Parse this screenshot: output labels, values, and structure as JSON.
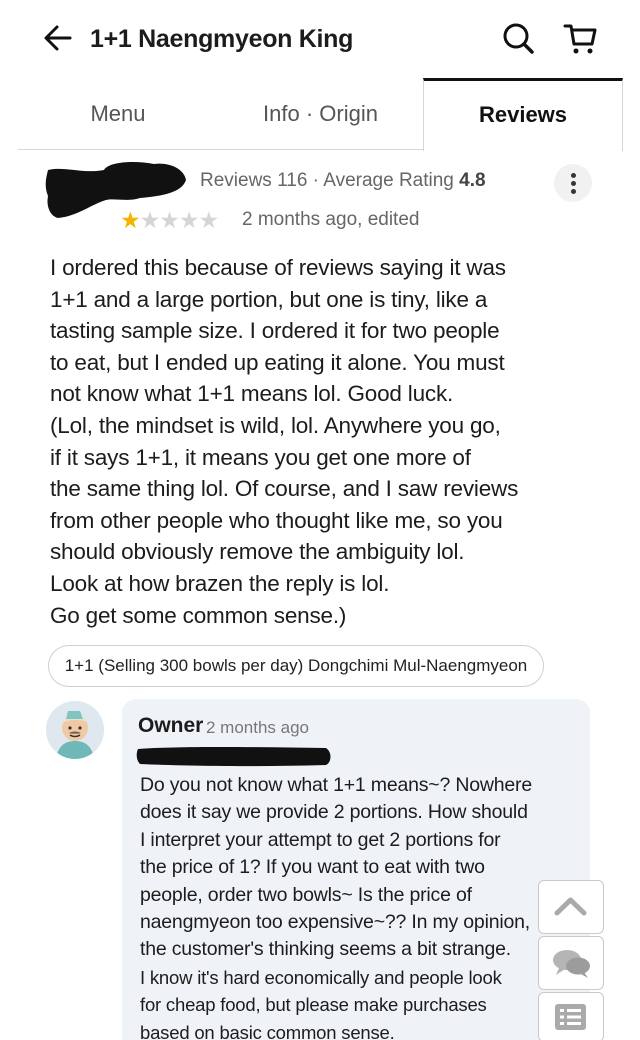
{
  "header": {
    "title": "1+1 Naengmyeon King"
  },
  "tabs": [
    {
      "label": "Menu"
    },
    {
      "label": "Info · Origin"
    },
    {
      "label": "Reviews"
    }
  ],
  "review": {
    "reviews_label": "Reviews",
    "reviews_count": "116",
    "separator": "·",
    "avg_label": "Average Rating",
    "avg_value": "4.8",
    "rating": 1,
    "rating_max": 5,
    "date": "2 months ago, edited",
    "lines": [
      "I ordered this because of reviews saying it was",
      "1+1 and a large portion, but one is tiny, like a",
      "tasting sample size. I ordered it for two people",
      "to eat, but I ended up eating it alone. You must",
      "not know what 1+1 means lol. Good luck.",
      "(Lol, the mindset is wild, lol. Anywhere you go,",
      "if it says 1+1, it means you get one more of",
      "the same thing lol. Of course, and I saw reviews",
      "from other people who thought like me, so you",
      "should obviously remove the ambiguity lol.",
      "Look at how brazen the reply is lol.",
      "Go get some common sense.)"
    ],
    "menu_item": "1+1 (Selling 300 bowls per day) Dongchimi Mul-Naengmyeon"
  },
  "reply": {
    "owner_label": "Owner",
    "date": "2 months ago",
    "lines": [
      "Do you not know what 1+1 means~? Nowhere",
      "does it say we provide 2 portions. How should",
      "I interpret your attempt to get 2 portions for",
      "the price of 1? If you want to eat with two",
      "people, order two bowls~ Is the price of",
      "naengmyeon too expensive~?? In my opinion,",
      "the customer's thinking seems a bit strange."
    ],
    "lines_small": [
      "I know it's hard economically and people look",
      "for cheap food, but please make purchases",
      "based on basic common sense."
    ]
  },
  "colors": {
    "star_filled": "#f5b400",
    "star_empty": "#d5d5d5",
    "reply_bg": "#eff3f7",
    "redaction": "#111111"
  },
  "icons": [
    "back-arrow-icon",
    "search-icon",
    "cart-icon",
    "more-vertical-icon",
    "star-icon",
    "chevron-up-icon",
    "chat-icon",
    "list-icon"
  ]
}
